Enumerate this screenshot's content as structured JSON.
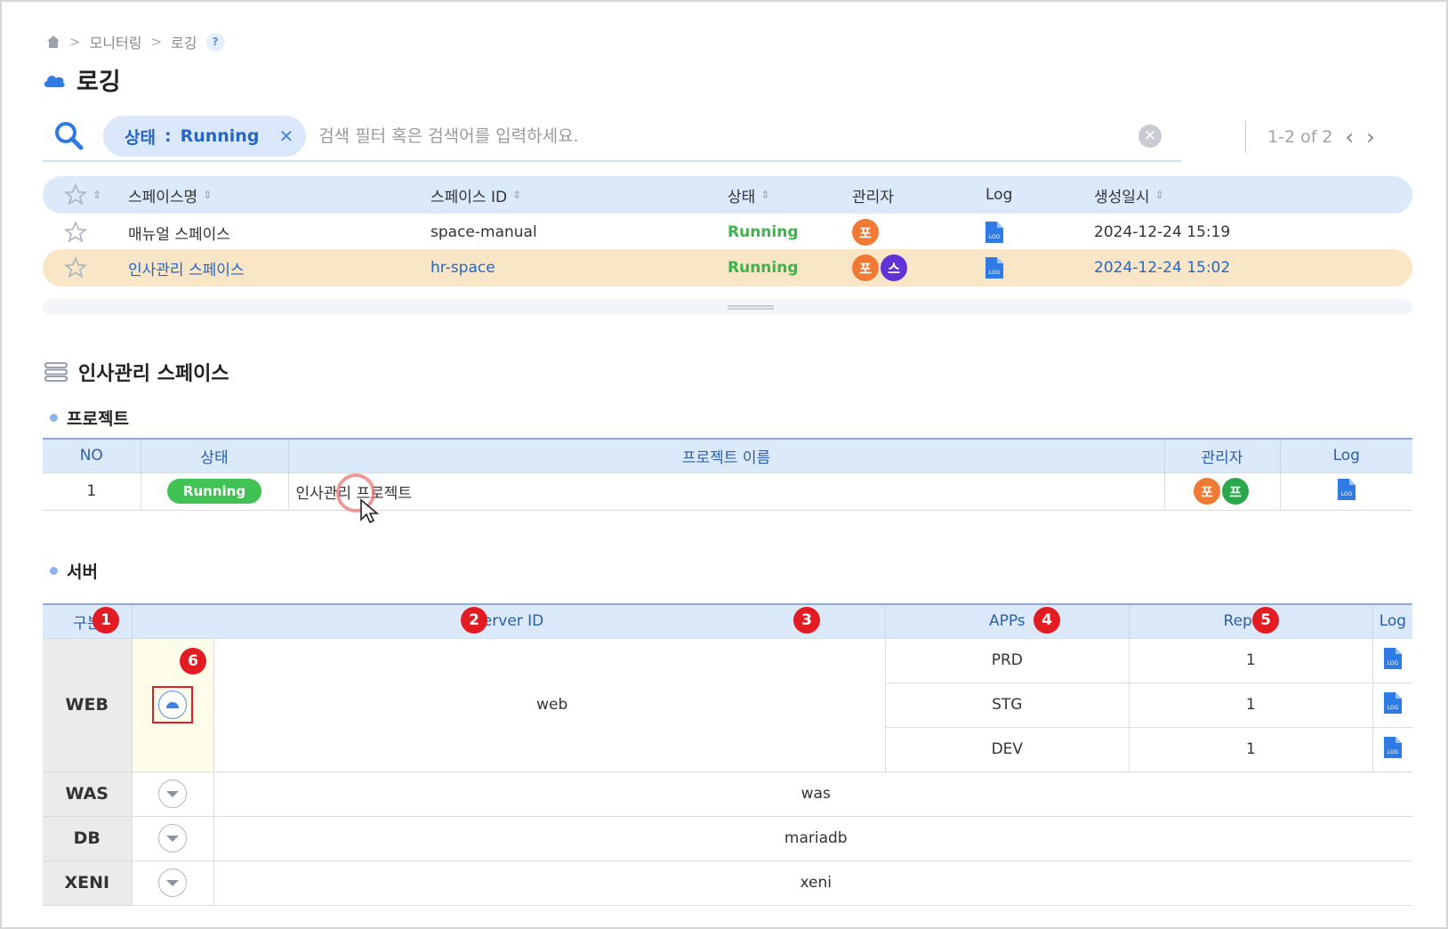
{
  "breadcrumb": {
    "level1": "모니터링",
    "level2": "로깅",
    "help": "?"
  },
  "page_title": "로깅",
  "search": {
    "chip_key": "상태",
    "chip_sep": ":",
    "chip_value": "Running",
    "placeholder": "검색 필터 혹은 검색어를 입력하세요."
  },
  "pager": {
    "range": "1-2 of 2"
  },
  "space_table": {
    "headers": {
      "name": "스페이스명",
      "id": "스페이스 ID",
      "status": "상태",
      "admin": "관리자",
      "log": "Log",
      "created": "생성일시"
    },
    "rows": [
      {
        "name": "매뉴얼 스페이스",
        "id": "space-manual",
        "status": "Running",
        "admins": [
          "포"
        ],
        "created": "2024-12-24 15:19"
      },
      {
        "name": "인사관리 스페이스",
        "id": "hr-space",
        "status": "Running",
        "admins": [
          "포",
          "스"
        ],
        "created": "2024-12-24 15:02"
      }
    ]
  },
  "detail": {
    "title": "인사관리 스페이스",
    "project_section": "프로젝트",
    "project_headers": {
      "no": "NO",
      "status": "상태",
      "name": "프로젝트 이름",
      "admin": "관리자",
      "log": "Log"
    },
    "projects": [
      {
        "no": "1",
        "status": "Running",
        "name": "인사관리 프로젝트",
        "admins": [
          "포",
          "프"
        ]
      }
    ],
    "server_section": "서버",
    "server_headers": {
      "kind": "구분",
      "server_id": "Server ID",
      "apps": "APPs",
      "replica": "Replica",
      "log": "Log"
    },
    "servers": [
      {
        "kind": "WEB",
        "id": "web",
        "expanded": true,
        "apps": [
          {
            "app": "PRD",
            "replica": "1"
          },
          {
            "app": "STG",
            "replica": "1"
          },
          {
            "app": "DEV",
            "replica": "1"
          }
        ]
      },
      {
        "kind": "WAS",
        "id": "was"
      },
      {
        "kind": "DB",
        "id": "mariadb"
      },
      {
        "kind": "XENI",
        "id": "xeni"
      }
    ]
  },
  "callouts": [
    "1",
    "2",
    "3",
    "4",
    "5",
    "6"
  ],
  "icons": {
    "log_label": "LOG"
  },
  "colors": {
    "accent": "#2566c7",
    "status_green": "#39b54a",
    "selected_row": "#f8e6c6",
    "callout_red": "#e31b23"
  }
}
